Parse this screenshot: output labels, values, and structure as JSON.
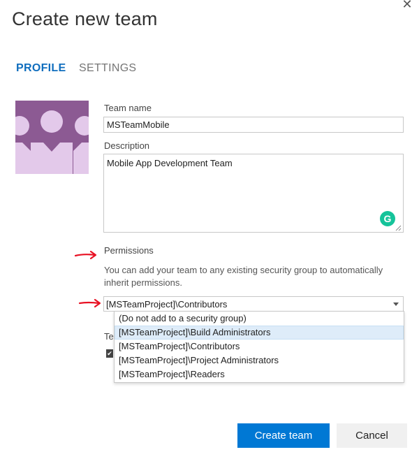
{
  "dialog": {
    "title": "Create new team",
    "close_icon": "close-icon"
  },
  "tabs": [
    {
      "label": "PROFILE",
      "active": true
    },
    {
      "label": "SETTINGS",
      "active": false
    }
  ],
  "profile": {
    "avatar_icon": "team-avatar-icon",
    "team_name_label": "Team name",
    "team_name_value": "MSTeamMobile",
    "description_label": "Description",
    "description_value": "Mobile App Development Team",
    "grammarly_badge": "G",
    "permissions_label": "Permissions",
    "permissions_help": "You can add your team to any existing security group to automatically inherit permissions.",
    "permissions_selected": "[MSTeamProject]\\Contributors",
    "permissions_options": [
      "(Do not add to a security group)",
      "[MSTeamProject]\\Build Administrators",
      "[MSTeamProject]\\Contributors",
      "[MSTeamProject]\\Project Administrators",
      "[MSTeamProject]\\Readers"
    ],
    "highlighted_option_index": 1,
    "partial_label": "Te"
  },
  "footer": {
    "create_label": "Create team",
    "cancel_label": "Cancel"
  },
  "annotations": {
    "arrow_color": "#e81123"
  },
  "colors": {
    "accent": "#0078d4",
    "tab_active": "#106ebe",
    "avatar_bg": "#8c5a93",
    "avatar_fg": "#e3c9ea",
    "grammarly": "#15c39a"
  }
}
